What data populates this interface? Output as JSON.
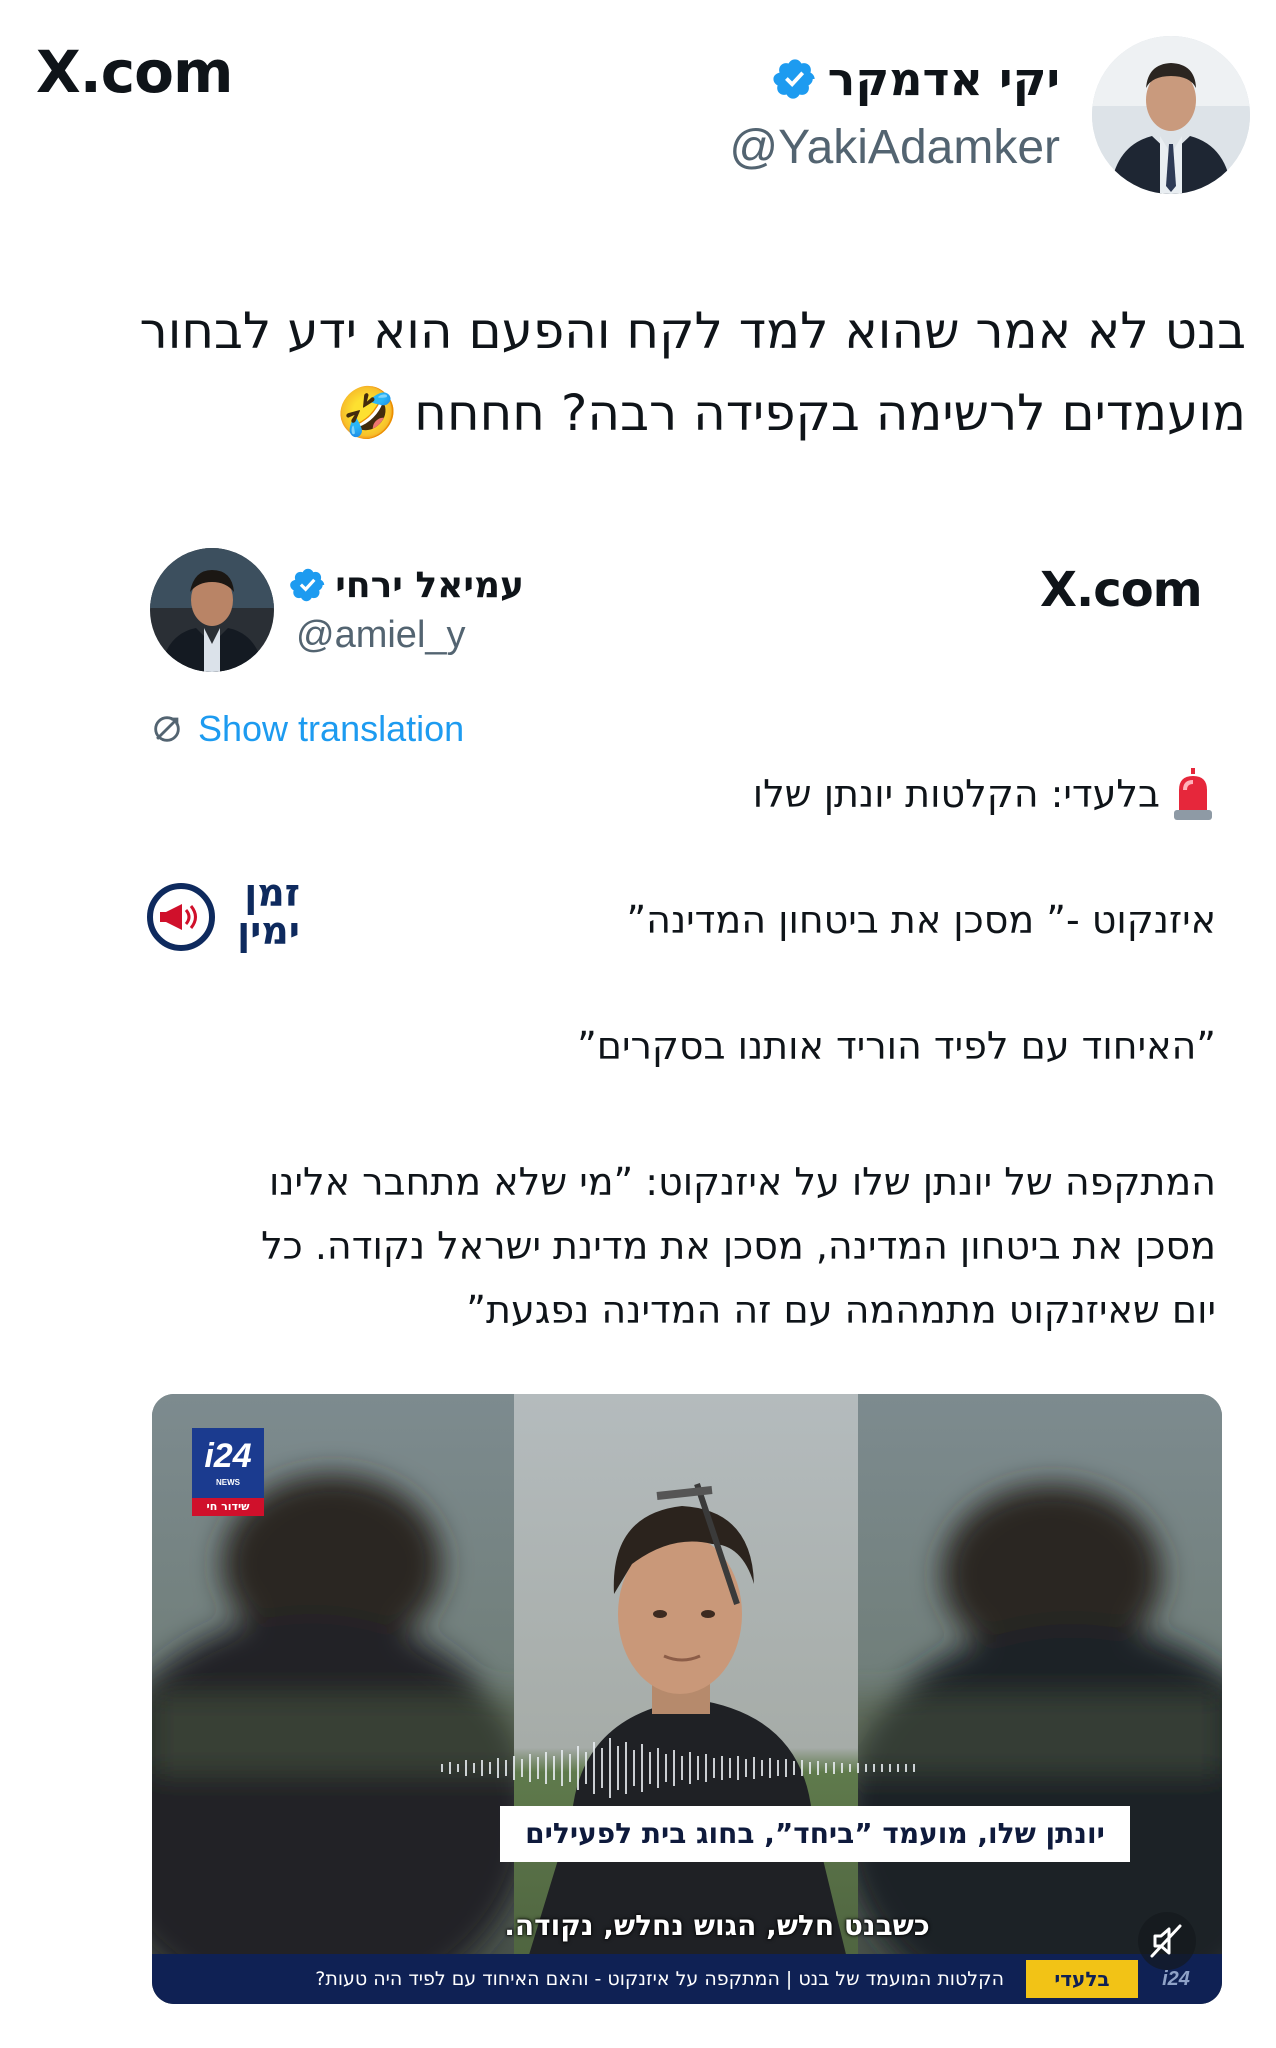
{
  "outer": {
    "site_logo": "X.com",
    "author": {
      "display_name": "יקי אדמקר",
      "handle": "@YakiAdamker"
    },
    "text_lines": [
      "בנט לא אמר שהוא למד לקח והפעם הוא ידע לבחור",
      "מועמדים לרשימה בקפידה רבה? חחחח 🤣"
    ]
  },
  "quoted": {
    "site_logo": "X.com",
    "author": {
      "display_name": "עמיאל ירחי",
      "handle": "@amiel_y"
    },
    "show_translation": "Show translation",
    "headline": "בלעדי: הקלטות יונתן שלו",
    "line_1": "איזנקוט -” מסכן את ביטחון המדינה”",
    "line_2": "”האיחוד עם לפיד הוריד אותנו בסקרים”",
    "paragraph_lines": [
      "המתקפה של יונתן שלו על איזנקוט: ”מי שלא מתחבר אלינו",
      "מסכן את ביטחון המדינה, מסכן את מדינת ישראל נקודה. כל",
      "יום שאיזנקוט מתמהמה עם זה המדינה נפגעת”"
    ],
    "brand_logo_lines": [
      "זמן",
      "ימין"
    ]
  },
  "video": {
    "channel_logo": "i24",
    "channel_sub": "NEWS",
    "live_label": "שידור חי",
    "caption": "יונתן שלו, מועמד ”ביחד”, בחוג בית לפעילים",
    "subtitle": "כשבנט חלש, הגוש נחלש, נקודה.",
    "ticker_tag": "בלעדי",
    "ticker_text": "הקלטות המועמד של בנט | המתקפה על איזנקוט - והאם האיחוד עם לפיד היה טעות?",
    "ticker_corner": "i24"
  },
  "icons": {
    "verified": "verified-badge-icon",
    "translate": "translate-icon",
    "siren": "siren-emoji-icon",
    "laugh": "rolling-laughing-emoji-icon",
    "mute": "mute-icon",
    "megaphone": "megaphone-clock-icon"
  },
  "colors": {
    "link_blue": "#1d9bf0",
    "verified_blue": "#1d9bf0",
    "handle_gray": "#536471",
    "ticker_navy": "#0f2154",
    "ticker_yellow": "#f2c316",
    "i24_red": "#d0102b"
  }
}
